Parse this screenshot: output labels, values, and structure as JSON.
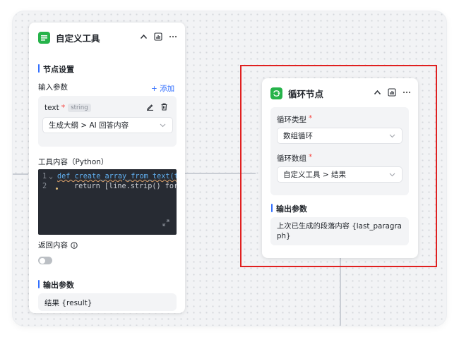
{
  "tool_node": {
    "title": "自定义工具",
    "section_node_settings": "节点设置",
    "input_params_label": "输入参数",
    "add_label": "+ 添加",
    "param": {
      "name": "text",
      "required_mark": "*",
      "type_badge": "string",
      "value": "生成大纲 > AI 回答内容"
    },
    "tool_content_label": "工具内容（Python）",
    "code_lines": [
      {
        "num": "1",
        "fold": "⌄",
        "text": "def create_array_from_text(t"
      },
      {
        "num": "2",
        "text": "return [line.strip() for"
      }
    ],
    "return_content_label": "返回内容",
    "output_params_label": "输出参数",
    "output_value": "结果 {result}"
  },
  "loop_node": {
    "title": "循环节点",
    "loop_type_label": "循环类型",
    "loop_type_value": "数组循环",
    "loop_array_label": "循环数组",
    "loop_array_value": "自定义工具 > 结果",
    "required_mark": "*",
    "output_params_label": "输出参数",
    "output_value": "上次已生成的段落内容 {last_paragraph}"
  },
  "colors": {
    "accent": "#3370ff",
    "node_icon": "#26b34a",
    "highlight": "#e02020",
    "required": "#f54a45"
  }
}
